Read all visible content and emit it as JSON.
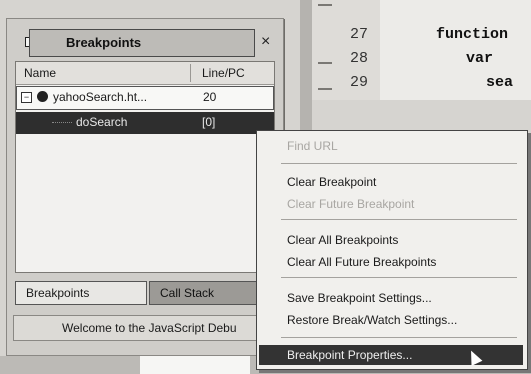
{
  "panel": {
    "title": "Breakpoints",
    "close_label": "×",
    "columns": {
      "name": "Name",
      "line": "Line/PC"
    },
    "rows": [
      {
        "name": "yahooSearch.ht...",
        "line": "20",
        "expander": "−"
      },
      {
        "name": "doSearch",
        "line": "[0]"
      }
    ],
    "tabs": [
      "Breakpoints",
      "Call Stack"
    ],
    "status": "Welcome to the JavaScript Debu"
  },
  "editor": {
    "line_numbers": [
      "27",
      "28",
      "29"
    ],
    "code_lines": [
      "function",
      "var",
      "sea"
    ]
  },
  "menu": {
    "items": [
      {
        "label": "Find URL",
        "enabled": false
      },
      {
        "label": "Clear Breakpoint",
        "enabled": true
      },
      {
        "label": "Clear Future Breakpoint",
        "enabled": false
      },
      {
        "label": "Clear All Breakpoints",
        "enabled": true
      },
      {
        "label": "Clear All Future Breakpoints",
        "enabled": true
      },
      {
        "label": "Save Breakpoint Settings...",
        "enabled": true
      },
      {
        "label": "Restore Break/Watch Settings...",
        "enabled": true
      },
      {
        "label": "Breakpoint Properties...",
        "enabled": true,
        "highlighted": true
      }
    ]
  }
}
